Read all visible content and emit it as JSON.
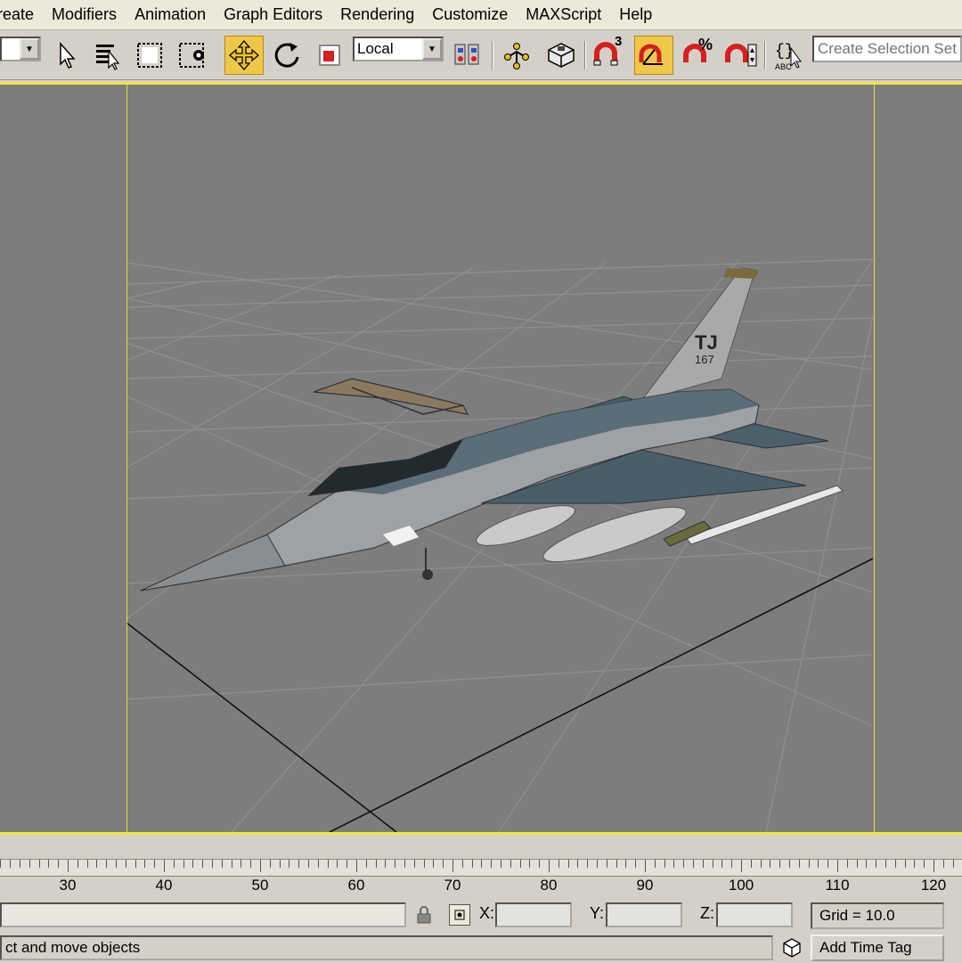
{
  "menu": [
    "reate",
    "Modifiers",
    "Animation",
    "Graph Editors",
    "Rendering",
    "Customize",
    "MAXScript",
    "Help"
  ],
  "toolbar": {
    "coordinate_system": "Local",
    "selection_set_placeholder": "Create Selection Set",
    "snap_number": "3",
    "percent_snap": "%",
    "active_tool": "select-and-move"
  },
  "viewport": {
    "tail_code": "TJ",
    "tail_number": "167",
    "grid_color": "#909090",
    "background": "#7d7d7d",
    "frame_color": "#f4e33c"
  },
  "timeline": {
    "labels": [
      "30",
      "40",
      "50",
      "60",
      "70",
      "80",
      "90",
      "100",
      "110",
      "120"
    ]
  },
  "status": {
    "x_label": "X:",
    "y_label": "Y:",
    "z_label": "Z:",
    "grid": "Grid = 10.0",
    "prompt": "ct and move objects",
    "time_tag": "Add Time Tag"
  }
}
